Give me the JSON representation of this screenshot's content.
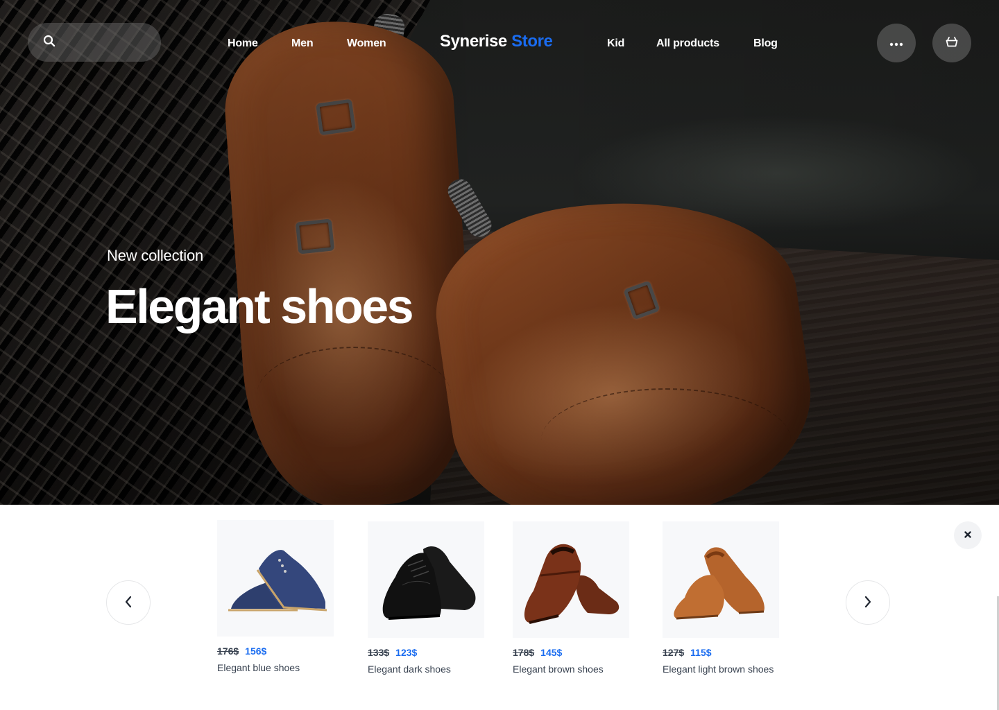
{
  "header": {
    "search": {
      "placeholder": "",
      "icon": "search-icon"
    },
    "nav_left": [
      {
        "label": "Home"
      },
      {
        "label": "Men"
      },
      {
        "label": "Women"
      }
    ],
    "logo": {
      "primary": "Synerise",
      "accent": "Store",
      "accent_color": "#1a6cf0"
    },
    "nav_right": [
      {
        "label": "Kid"
      },
      {
        "label": "All products"
      },
      {
        "label": "Blog"
      }
    ],
    "actions": [
      {
        "name": "more",
        "icon": "more-dots-icon"
      },
      {
        "name": "cart",
        "icon": "basket-icon"
      }
    ]
  },
  "hero": {
    "kicker": "New collection",
    "title": "Elegant shoes",
    "image": "brown-monk-strap-shoes"
  },
  "recommendations": {
    "prev_icon": "chevron-left-icon",
    "next_icon": "chevron-right-icon",
    "close_icon": "close-icon",
    "items": [
      {
        "name": "Elegant blue shoes",
        "old_price": "176$",
        "price": "156$",
        "image": "blue-derby-shoes"
      },
      {
        "name": "Elegant dark shoes",
        "old_price": "133$",
        "price": "123$",
        "image": "black-oxford-shoes"
      },
      {
        "name": "Elegant brown shoes",
        "old_price": "178$",
        "price": "145$",
        "image": "brown-loafers"
      },
      {
        "name": "Elegant light brown shoes",
        "old_price": "127$",
        "price": "115$",
        "image": "light-brown-loafers"
      }
    ]
  },
  "colors": {
    "accent": "#1a6cf0",
    "text_dark": "#384250",
    "card_bg": "#f7f8fa"
  }
}
